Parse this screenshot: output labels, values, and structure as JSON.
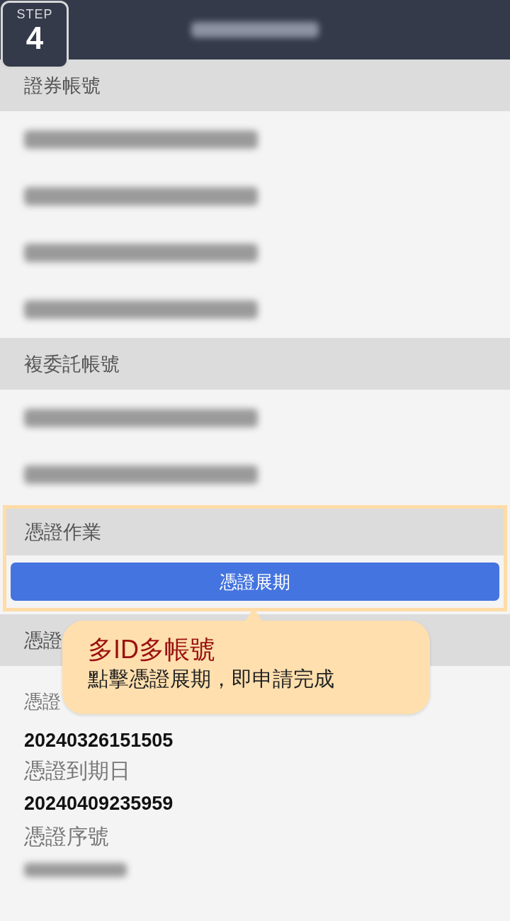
{
  "step_badge": {
    "label": "STEP",
    "number": "4"
  },
  "header": {
    "title": {
      "kind": "redacted"
    }
  },
  "sections": [
    {
      "title": "證券帳號",
      "highlighted": false,
      "items": [
        {
          "kind": "redacted"
        },
        {
          "kind": "redacted"
        },
        {
          "kind": "redacted"
        },
        {
          "kind": "redacted"
        }
      ]
    },
    {
      "title": "複委託帳號",
      "highlighted": false,
      "items": [
        {
          "kind": "redacted"
        },
        {
          "kind": "redacted"
        }
      ]
    },
    {
      "title": "憑證作業",
      "highlighted": true,
      "items": [
        {
          "kind": "button",
          "label": "憑證展期"
        }
      ]
    },
    {
      "title": "憑證",
      "highlighted": false,
      "items": [
        {
          "kind": "label",
          "text": "憑證"
        },
        {
          "kind": "value",
          "text": "20240326151505"
        },
        {
          "kind": "label",
          "text": "憑證到期日"
        },
        {
          "kind": "value",
          "text": "20240409235959"
        },
        {
          "kind": "label",
          "text": "憑證序號"
        },
        {
          "kind": "redacted_small"
        }
      ]
    }
  ],
  "callout": {
    "title": "多ID多帳號",
    "text": "點擊憑證展期，即申請完成"
  }
}
